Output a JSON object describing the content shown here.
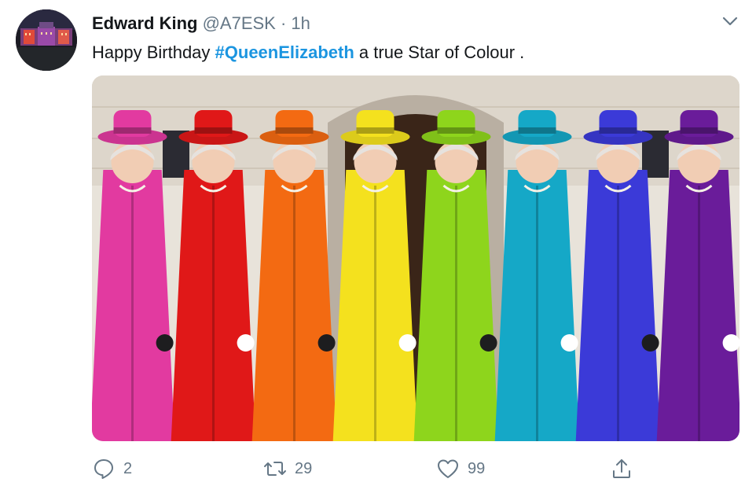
{
  "tweet": {
    "author": {
      "display_name": "Edward King",
      "handle": "@A7ESK"
    },
    "separator": "·",
    "time": "1h",
    "text_before": "Happy Birthday ",
    "hashtag": "#QueenElizabeth",
    "text_after": " a true Star of Colour .",
    "media": {
      "outfit_colors": [
        "#e23aa0",
        "#e01818",
        "#f36a12",
        "#f4e11e",
        "#8ed51c",
        "#15a8c7",
        "#3b3ad8",
        "#6a1c9a"
      ]
    }
  },
  "actions": {
    "reply": {
      "icon": "reply-icon",
      "count": "2"
    },
    "retweet": {
      "icon": "retweet-icon",
      "count": "29"
    },
    "like": {
      "icon": "heart-icon",
      "count": "99"
    },
    "share": {
      "icon": "share-icon"
    }
  },
  "colors": {
    "accent": "#1b95e0",
    "secondary_text": "#657786",
    "primary_text": "#14171a"
  }
}
